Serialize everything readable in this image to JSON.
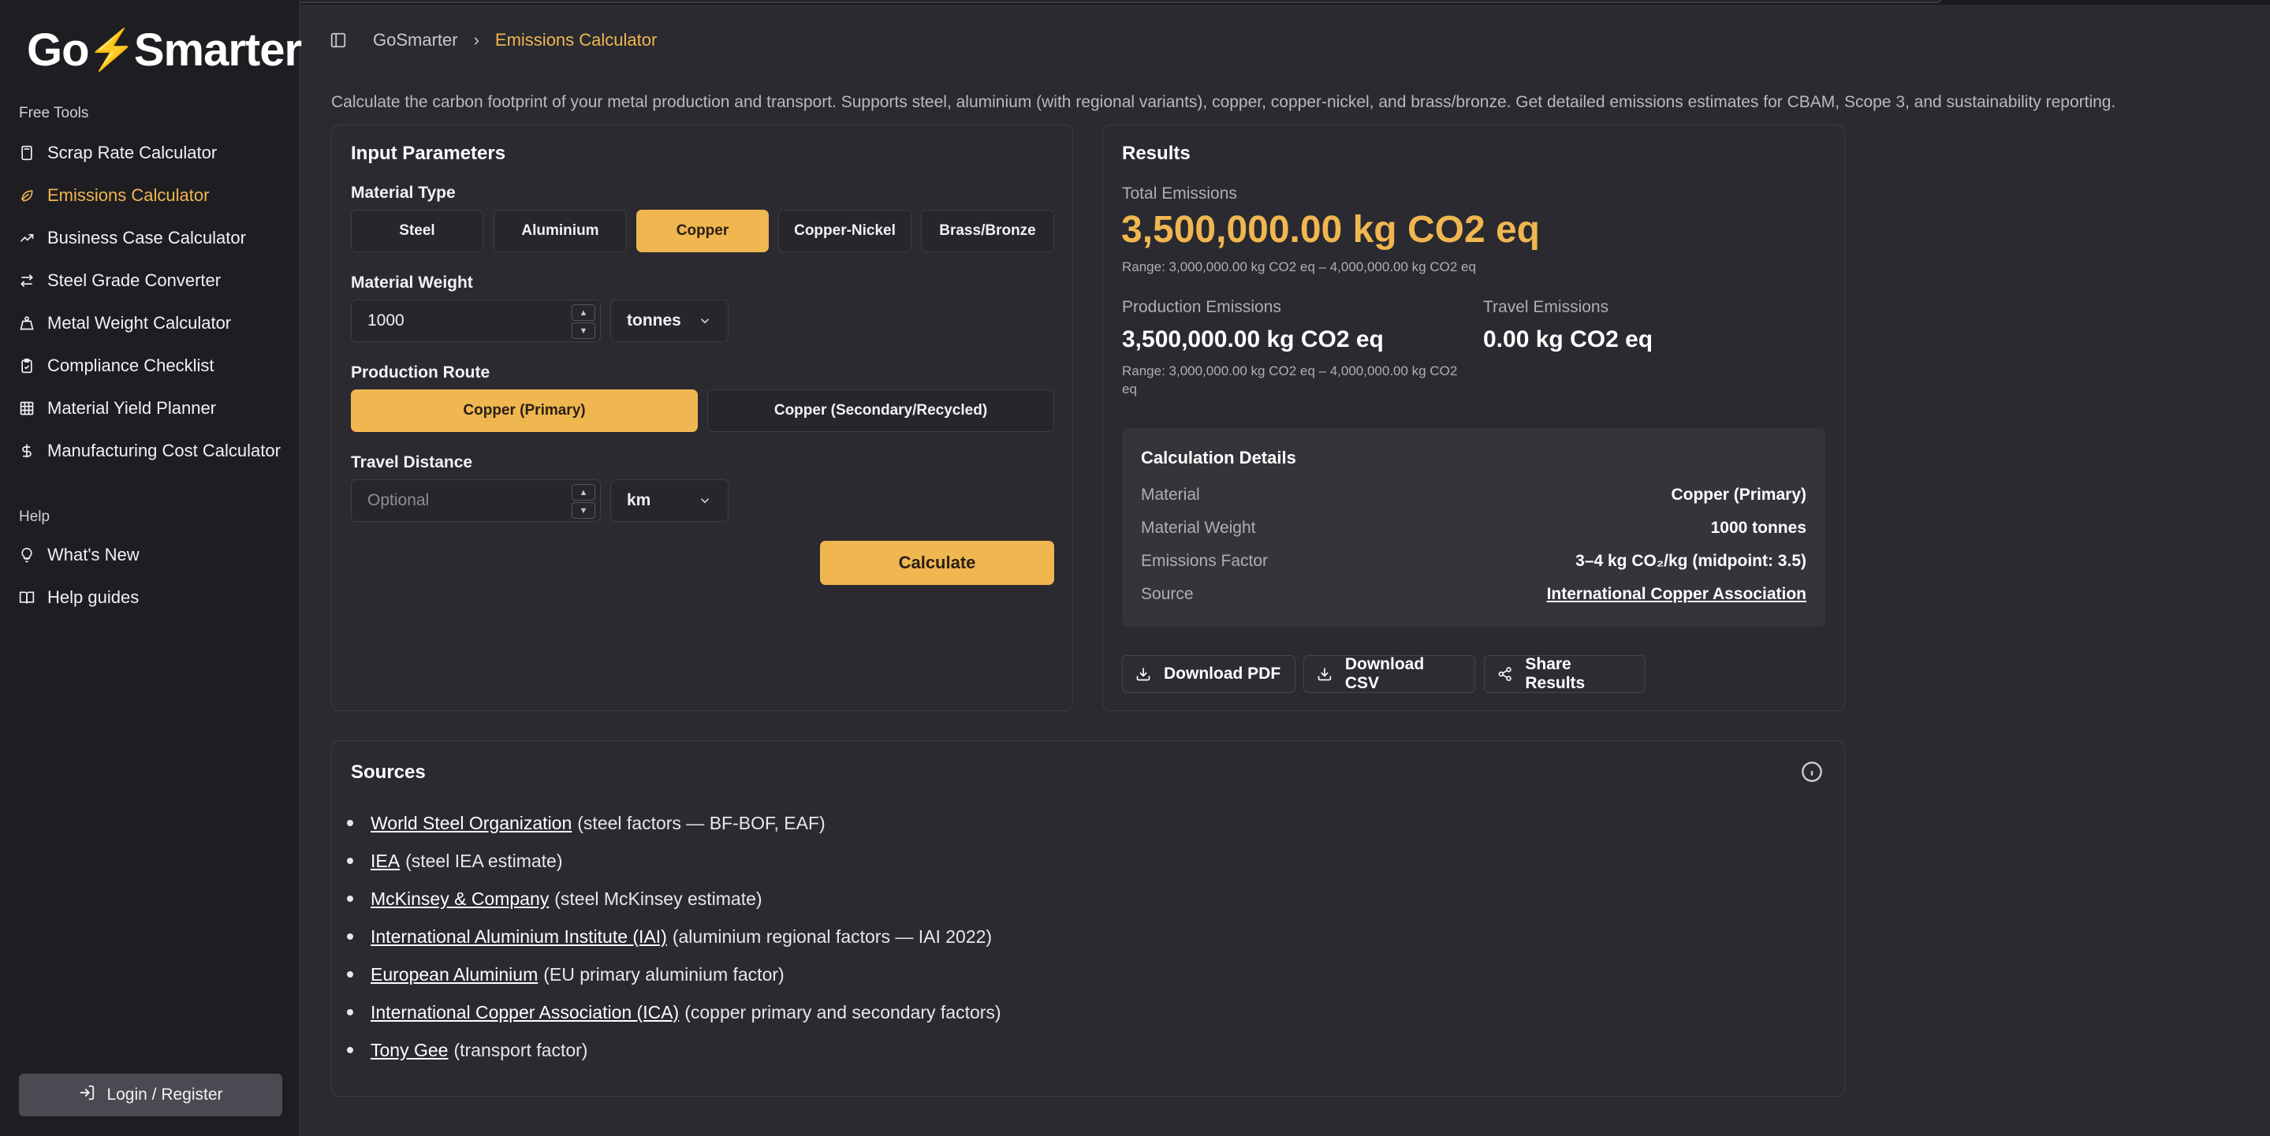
{
  "app": {
    "logo_left": "Go",
    "logo_right": "Smarter"
  },
  "sidebar": {
    "free_tools_heading": "Free Tools",
    "items": [
      {
        "label": "Scrap Rate Calculator",
        "icon": "calculator-icon"
      },
      {
        "label": "Emissions Calculator",
        "icon": "leaf-icon"
      },
      {
        "label": "Business Case Calculator",
        "icon": "trending-up-icon"
      },
      {
        "label": "Steel Grade Converter",
        "icon": "arrows-swap-icon"
      },
      {
        "label": "Metal Weight Calculator",
        "icon": "weight-icon"
      },
      {
        "label": "Compliance Checklist",
        "icon": "clipboard-check-icon"
      },
      {
        "label": "Material Yield Planner",
        "icon": "grid-icon"
      },
      {
        "label": "Manufacturing Cost Calculator",
        "icon": "dollar-icon"
      }
    ],
    "help_heading": "Help",
    "help_items": [
      {
        "label": "What's New",
        "icon": "lightbulb-icon"
      },
      {
        "label": "Help guides",
        "icon": "book-open-icon"
      }
    ],
    "login_label": "Login / Register"
  },
  "header": {
    "breadcrumb_home": "GoSmarter",
    "breadcrumb_current": "Emissions Calculator"
  },
  "intro": "Calculate the carbon footprint of your metal production and transport. Supports steel, aluminium (with regional variants), copper, copper-nickel, and brass/bronze. Get detailed emissions estimates for CBAM, Scope 3, and sustainability reporting.",
  "inputs": {
    "title": "Input Parameters",
    "material_type_label": "Material Type",
    "materials": [
      "Steel",
      "Aluminium",
      "Copper",
      "Copper-Nickel",
      "Brass/Bronze"
    ],
    "selected_material": "Copper",
    "weight_label": "Material Weight",
    "weight_value": "1000",
    "weight_unit": "tonnes",
    "route_label": "Production Route",
    "routes": [
      "Copper (Primary)",
      "Copper (Secondary/Recycled)"
    ],
    "selected_route": "Copper (Primary)",
    "distance_label": "Travel Distance",
    "distance_placeholder": "Optional",
    "distance_unit": "km",
    "calculate_label": "Calculate"
  },
  "results": {
    "title": "Results",
    "total_label": "Total Emissions",
    "total_value": "3,500,000.00 kg CO2 eq",
    "total_range": "Range: 3,000,000.00 kg CO2 eq – 4,000,000.00 kg CO2 eq",
    "production_label": "Production Emissions",
    "production_value": "3,500,000.00 kg CO2 eq",
    "production_range_line1": "Range: 3,000,000.00 kg CO2 eq – 4,000,000.00 kg CO2",
    "production_range_line2": "eq",
    "travel_label": "Travel Emissions",
    "travel_value": "0.00 kg CO2 eq",
    "details_title": "Calculation Details",
    "details": [
      {
        "k": "Material",
        "v": "Copper (Primary)"
      },
      {
        "k": "Material Weight",
        "v": "1000 tonnes"
      },
      {
        "k": "Emissions Factor",
        "v": "3–4 kg CO₂/kg (midpoint: 3.5)"
      },
      {
        "k": "Source",
        "v": "International Copper Association"
      }
    ],
    "download_pdf": "Download PDF",
    "download_csv": "Download CSV",
    "share": "Share Results"
  },
  "sources": {
    "title": "Sources",
    "items": [
      {
        "link": "World Steel Organization",
        "note": "(steel factors — BF-BOF, EAF)"
      },
      {
        "link": "IEA",
        "note": "(steel IEA estimate)"
      },
      {
        "link": "McKinsey & Company",
        "note": "(steel McKinsey estimate)"
      },
      {
        "link": "International Aluminium Institute (IAI)",
        "note": "(aluminium regional factors — IAI 2022)"
      },
      {
        "link": "European Aluminium",
        "note": "(EU primary aluminium factor)"
      },
      {
        "link": "International Copper Association (ICA)",
        "note": "(copper primary and secondary factors)"
      },
      {
        "link": "Tony Gee",
        "note": "(transport factor)"
      }
    ]
  },
  "colors": {
    "accent": "#f0b650",
    "background": "#2a2a30",
    "sidebar": "#1e1e22"
  }
}
